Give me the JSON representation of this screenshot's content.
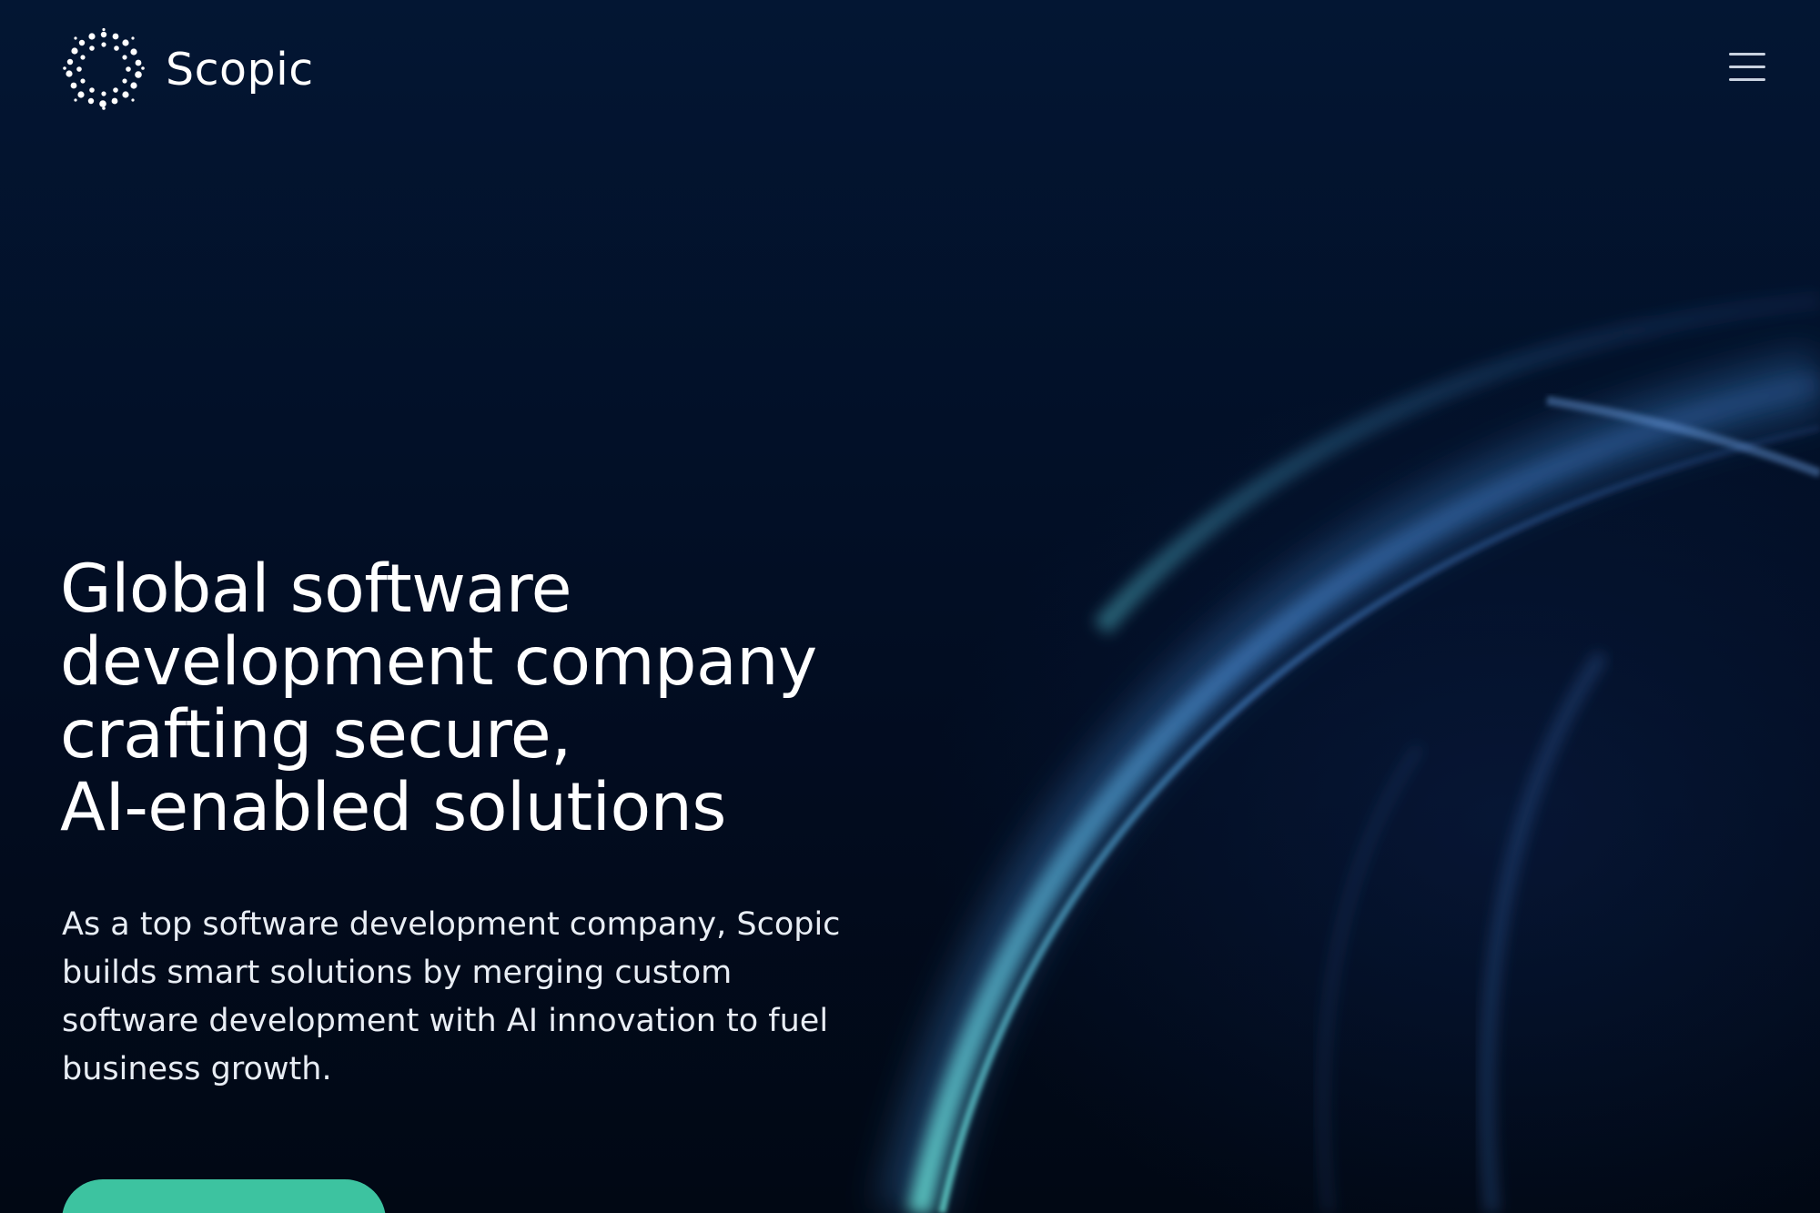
{
  "brand": {
    "name": "Scopic",
    "logo_icon": "dotted-circle-logo"
  },
  "header": {
    "menu_icon": "hamburger-menu-icon"
  },
  "hero": {
    "headline_lines": [
      "Global software",
      "development company",
      "crafting secure,",
      "AI-enabled solutions"
    ],
    "description_lines": [
      "As a top software development company, Scopic",
      "builds smart solutions by merging custom",
      "software development with AI innovation to fuel",
      "business growth."
    ],
    "cta_color": "#3dc3a0"
  },
  "colors": {
    "background": "#020f24",
    "text": "#ffffff",
    "accent": "#3dc3a0"
  }
}
